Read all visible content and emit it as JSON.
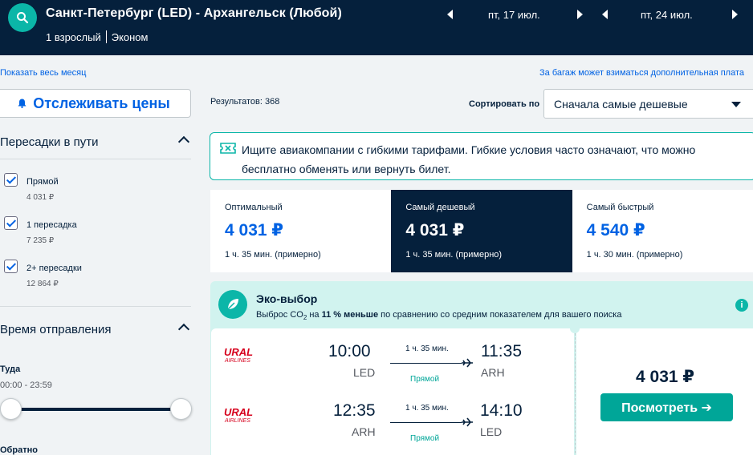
{
  "header": {
    "route": "Санкт-Петербург (LED) - Архангельск (Любой)",
    "passengers": "1 взрослый",
    "cabin": "Эконом",
    "depart_date": "пт, 17 июл.",
    "return_date": "пт, 24 июл."
  },
  "links": {
    "whole_month": "Показать весь месяц",
    "baggage_note": "За багаж может взиматься дополнительная плата"
  },
  "sidebar": {
    "track_prices": "Отслеживать цены",
    "stops_title": "Пересадки в пути",
    "stops": [
      {
        "label": "Прямой",
        "price": "4 031 ₽"
      },
      {
        "label": "1 пересадка",
        "price": "7 235 ₽"
      },
      {
        "label": "2+ пересадки",
        "price": "12 864 ₽"
      }
    ],
    "time_title": "Время отправления",
    "outbound_label": "Туда",
    "outbound_range": "00:00 - 23:59",
    "return_label": "Обратно"
  },
  "results": {
    "count_label": "Результатов: 368",
    "sort_label": "Сортировать по",
    "sort_value": "Сначала самые дешевые",
    "info_text": "Ищите авиакомпании с гибкими тарифами. Гибкие условия часто означают, что можно бесплатно обменять или вернуть билет."
  },
  "tabs": [
    {
      "title": "Оптимальный",
      "price": "4 031 ₽",
      "duration": "1 ч. 35 мин. (примерно)"
    },
    {
      "title": "Самый дешевый",
      "price": "4 031 ₽",
      "duration": "1 ч. 35 мин. (примерно)"
    },
    {
      "title": "Самый быстрый",
      "price": "4 540 ₽",
      "duration": "1 ч. 30 мин. (примерно)"
    }
  ],
  "eco": {
    "title": "Эко-выбор",
    "sub_prefix": "Выброс CO",
    "sub_sub": "2",
    "sub_mid": " на ",
    "sub_bold": "11 % меньше",
    "sub_suffix": " по сравнению со средним показателем для вашего поиска"
  },
  "ticket": {
    "airline": "URAL AIRLINES",
    "airline_word1": "URAL",
    "airline_word2": "AIRLINES",
    "outbound": {
      "dep_time": "10:00",
      "dep_code": "LED",
      "arr_time": "11:35",
      "arr_code": "ARH",
      "duration": "1 ч. 35 мин.",
      "stops": "Прямой"
    },
    "inbound": {
      "dep_time": "12:35",
      "dep_code": "ARH",
      "arr_time": "14:10",
      "arr_code": "LED",
      "duration": "1 ч. 35 мин.",
      "stops": "Прямой"
    },
    "price": "4 031 ₽",
    "view_button": "Посмотреть ➔"
  },
  "colors": {
    "navy": "#05203c",
    "accent_blue": "#0062e3",
    "teal": "#00a698",
    "eco_bg": "#d1f3ef",
    "brand_red": "#d6001c"
  }
}
